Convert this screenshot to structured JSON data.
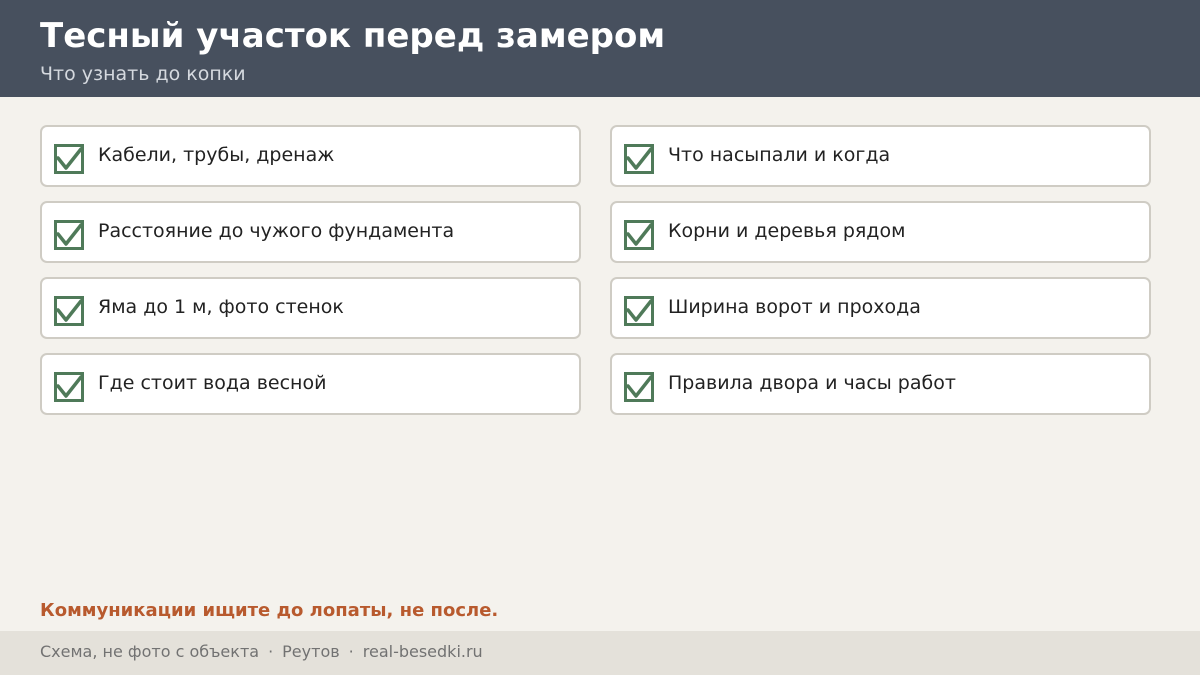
{
  "header": {
    "title": "Тесный участок перед замером",
    "subtitle": "Что узнать до копки"
  },
  "checklist": {
    "left": [
      {
        "label": "Кабели, трубы, дренаж",
        "checked": true
      },
      {
        "label": "Расстояние до чужого фундамента",
        "checked": true
      },
      {
        "label": "Яма до 1 м, фото стенок",
        "checked": true
      },
      {
        "label": "Где стоит вода весной",
        "checked": true
      }
    ],
    "right": [
      {
        "label": "Что насыпали и когда",
        "checked": true
      },
      {
        "label": "Корни и деревья рядом",
        "checked": true
      },
      {
        "label": "Ширина ворот и прохода",
        "checked": true
      },
      {
        "label": "Правила двора и часы работ",
        "checked": true
      }
    ]
  },
  "warning": "Коммуникации ищите до лопаты, не после.",
  "footer": {
    "note": "Схема, не фото с объекта",
    "separator": "·",
    "city": "Реутов",
    "site": "real-besedki.ru"
  },
  "colors": {
    "header_bg": "#47505e",
    "page_bg": "#f4f2ed",
    "check_green": "#4f7a59",
    "warning_orange": "#b85a2e",
    "footer_bg": "#e4e1da"
  },
  "icons": {
    "check": "checkbox-checked-icon"
  }
}
